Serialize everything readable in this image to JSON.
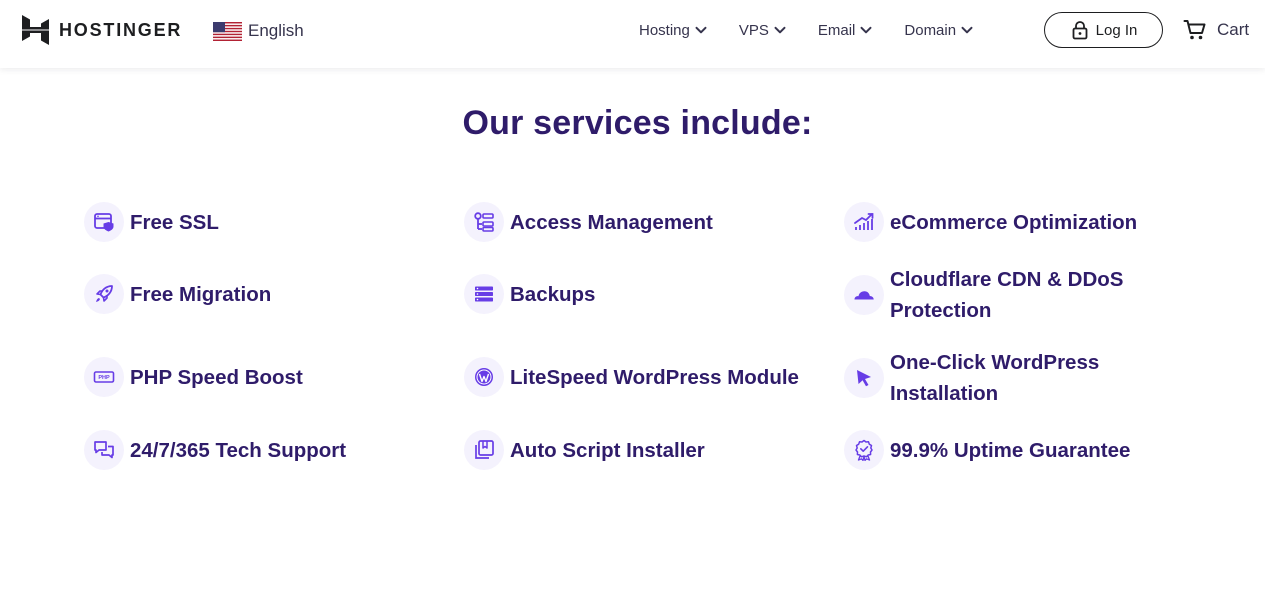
{
  "brand": {
    "name": "HOSTINGER"
  },
  "language": {
    "label": "English"
  },
  "nav": {
    "items": [
      {
        "label": "Hosting"
      },
      {
        "label": "VPS"
      },
      {
        "label": "Email"
      },
      {
        "label": "Domain"
      }
    ]
  },
  "header": {
    "login_label": "Log In",
    "cart_label": "Cart"
  },
  "main": {
    "title": "Our services include:",
    "services": [
      {
        "label": "Free SSL",
        "icon": "ssl-icon"
      },
      {
        "label": "Access Management",
        "icon": "access-management-icon"
      },
      {
        "label": "eCommerce Optimization",
        "icon": "chart-icon"
      },
      {
        "label": "Free Migration",
        "icon": "rocket-icon"
      },
      {
        "label": "Backups",
        "icon": "server-icon"
      },
      {
        "label": "Cloudflare CDN & DDoS Protection",
        "icon": "cloudflare-icon"
      },
      {
        "label": "PHP Speed Boost",
        "icon": "php-icon"
      },
      {
        "label": "LiteSpeed WordPress Module",
        "icon": "wordpress-icon"
      },
      {
        "label": "One-Click WordPress Installation",
        "icon": "cursor-icon"
      },
      {
        "label": "24/7/365 Tech Support",
        "icon": "chat-icon"
      },
      {
        "label": "Auto Script Installer",
        "icon": "installer-icon"
      },
      {
        "label": "99.9% Uptime Guarantee",
        "icon": "badge-icon"
      }
    ]
  },
  "colors": {
    "heading": "#2f1c6a",
    "accent": "#673de6",
    "icon_bg": "#f4f2fd",
    "text_dark": "#1d1e20"
  }
}
